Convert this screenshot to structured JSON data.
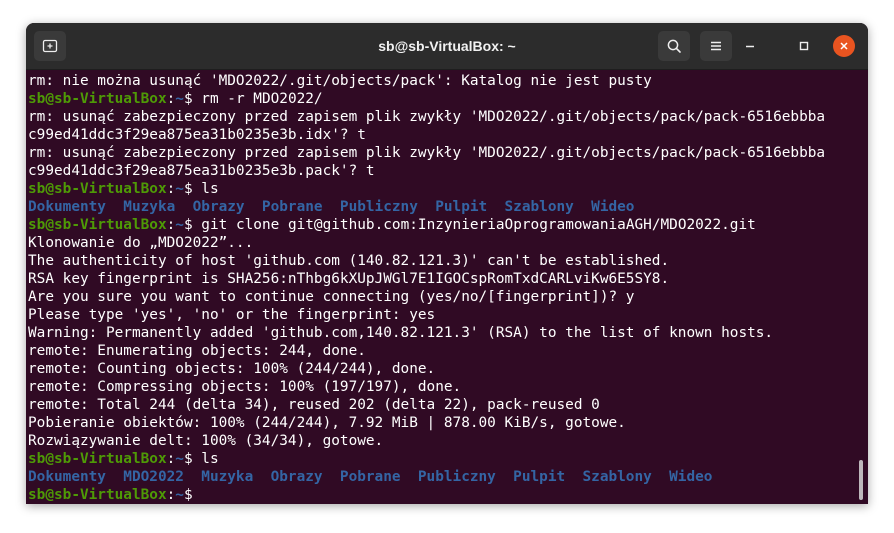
{
  "window": {
    "title": "sb@sb-VirtualBox: ~"
  },
  "icons": {
    "new_tab": "new-tab-icon",
    "search": "search-icon",
    "menu": "hamburger-menu-icon",
    "minimize": "minimize-icon",
    "maximize": "maximize-icon",
    "close": "close-icon"
  },
  "colors": {
    "terminal_bg": "#300a24",
    "prompt_user": "#4e9a06",
    "prompt_path": "#3465a4",
    "directory": "#3465a4",
    "close_button": "#e95420"
  },
  "prompt": {
    "user_host": "sb@sb-VirtualBox",
    "separator": ":",
    "path": "~",
    "symbol": "$"
  },
  "terminal": {
    "lines": [
      {
        "type": "output",
        "text": "rm: nie można usunąć 'MDO2022/.git/objects/pack': Katalog nie jest pusty"
      },
      {
        "type": "command",
        "text": " rm -r MDO2022/"
      },
      {
        "type": "output",
        "text": "rm: usunąć zabezpieczony przed zapisem plik zwykły 'MDO2022/.git/objects/pack/pack-6516ebbba"
      },
      {
        "type": "output",
        "text": "c99ed41ddc3f29ea875ea31b0235e3b.idx'? t"
      },
      {
        "type": "output",
        "text": "rm: usunąć zabezpieczony przed zapisem plik zwykły 'MDO2022/.git/objects/pack/pack-6516ebbba"
      },
      {
        "type": "output",
        "text": "c99ed41ddc3f29ea875ea31b0235e3b.pack'? t"
      },
      {
        "type": "command",
        "text": " ls"
      },
      {
        "type": "dirs",
        "text": "Dokumenty  Muzyka  Obrazy  Pobrane  Publiczny  Pulpit  Szablony  Wideo"
      },
      {
        "type": "command",
        "text": " git clone git@github.com:InzynieriaOprogramowaniaAGH/MDO2022.git"
      },
      {
        "type": "output",
        "text": "Klonowanie do „MDO2022”..."
      },
      {
        "type": "output",
        "text": "The authenticity of host 'github.com (140.82.121.3)' can't be established."
      },
      {
        "type": "output",
        "text": "RSA key fingerprint is SHA256:nThbg6kXUpJWGl7E1IGOCspRomTxdCARLviKw6E5SY8."
      },
      {
        "type": "output",
        "text": "Are you sure you want to continue connecting (yes/no/[fingerprint])? y"
      },
      {
        "type": "output",
        "text": "Please type 'yes', 'no' or the fingerprint: yes"
      },
      {
        "type": "output",
        "text": "Warning: Permanently added 'github.com,140.82.121.3' (RSA) to the list of known hosts."
      },
      {
        "type": "output",
        "text": "remote: Enumerating objects: 244, done."
      },
      {
        "type": "output",
        "text": "remote: Counting objects: 100% (244/244), done."
      },
      {
        "type": "output",
        "text": "remote: Compressing objects: 100% (197/197), done."
      },
      {
        "type": "output",
        "text": "remote: Total 244 (delta 34), reused 202 (delta 22), pack-reused 0"
      },
      {
        "type": "output",
        "text": "Pobieranie obiektów: 100% (244/244), 7.92 MiB | 878.00 KiB/s, gotowe."
      },
      {
        "type": "output",
        "text": "Rozwiązywanie delt: 100% (34/34), gotowe."
      },
      {
        "type": "command",
        "text": " ls"
      },
      {
        "type": "dirs",
        "text": "Dokumenty  MDO2022  Muzyka  Obrazy  Pobrane  Publiczny  Pulpit  Szablony  Wideo"
      },
      {
        "type": "command",
        "text": " "
      }
    ]
  }
}
